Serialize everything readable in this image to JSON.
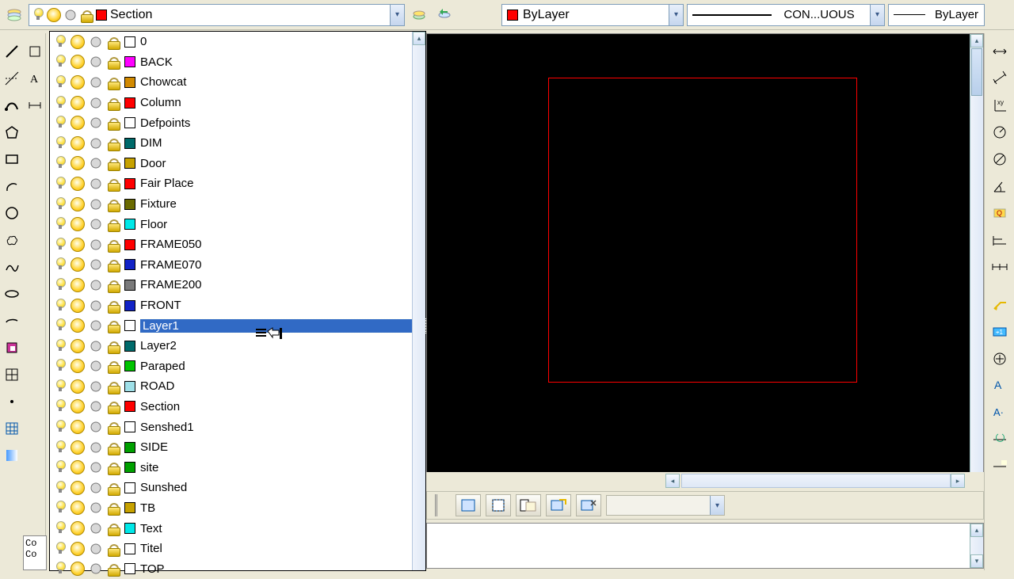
{
  "toolbar": {
    "current_layer": "Section",
    "current_layer_color": "#ff0000",
    "color_dd": {
      "label": "ByLayer",
      "swatch": "#ff0000"
    },
    "linetype_dd": {
      "label": "CON...UOUS"
    },
    "lineweight_dd": {
      "label": "ByLayer"
    }
  },
  "layers": [
    {
      "name": "0",
      "color": "#ffffff"
    },
    {
      "name": "BACK",
      "color": "#ff00ff"
    },
    {
      "name": "Chowcat",
      "color": "#d28a00"
    },
    {
      "name": "Column",
      "color": "#ff0000"
    },
    {
      "name": "Defpoints",
      "color": "#ffffff"
    },
    {
      "name": "DIM",
      "color": "#006a6a"
    },
    {
      "name": "Door",
      "color": "#c7a200"
    },
    {
      "name": "Fair Place",
      "color": "#ff0000"
    },
    {
      "name": "Fixture",
      "color": "#6a6a00"
    },
    {
      "name": "Floor",
      "color": "#00e8e8"
    },
    {
      "name": "FRAME050",
      "color": "#ff0000"
    },
    {
      "name": "FRAME070",
      "color": "#1223c6"
    },
    {
      "name": "FRAME200",
      "color": "#7a7a7a"
    },
    {
      "name": "FRONT",
      "color": "#1223c6"
    },
    {
      "name": "Layer1",
      "color": "#ffffff",
      "selected": true
    },
    {
      "name": "Layer2",
      "color": "#006a6a"
    },
    {
      "name": "Paraped",
      "color": "#00c400"
    },
    {
      "name": "ROAD",
      "color": "#9fe0e8"
    },
    {
      "name": "Section",
      "color": "#ff0000"
    },
    {
      "name": "Senshed1",
      "color": "#ffffff"
    },
    {
      "name": "SIDE",
      "color": "#00a000"
    },
    {
      "name": "site",
      "color": "#00a000"
    },
    {
      "name": "Sunshed",
      "color": "#ffffff"
    },
    {
      "name": "TB",
      "color": "#c7a200"
    },
    {
      "name": "Text",
      "color": "#00e8e8"
    },
    {
      "name": "Titel",
      "color": "#ffffff"
    },
    {
      "name": "TOP",
      "color": "#ffffff"
    }
  ],
  "canvas": {
    "watermark": ""
  },
  "cmd": {
    "line1": "Co",
    "line2": "Co"
  }
}
